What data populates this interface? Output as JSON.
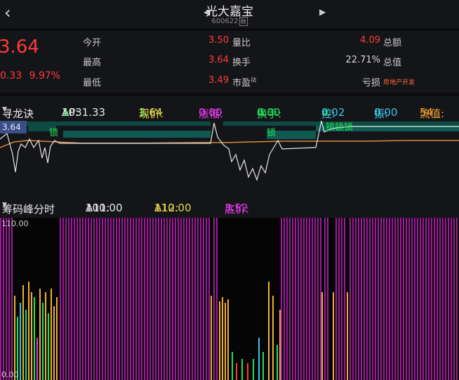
{
  "header": {
    "title": "光大嘉宝",
    "code": "600622",
    "code_tag": "融",
    "back_icon": "chevron-left-icon",
    "prev_icon": "triangle-left-icon",
    "next_icon": "triangle-right-icon"
  },
  "quote": {
    "price": "3.64",
    "change": "0.33",
    "change_pct": "9.97%",
    "rows": [
      {
        "label1": "今开",
        "value1": "3.50",
        "label2": "量比",
        "value2": "4.09",
        "label3": "总额"
      },
      {
        "label1": "最高",
        "value1": "3.64",
        "label2": "换手",
        "value2": "22.71%",
        "label3": "总值"
      },
      {
        "label1": "最低",
        "value1": "3.49",
        "label2": "市盈",
        "label2_sup": "动",
        "value2": "亏损",
        "label3": "房地产开发"
      }
    ]
  },
  "indicator1": {
    "selector": "寻龙诀",
    "items": [
      {
        "label": "AP:",
        "value": "1031.33",
        "arrow": "↓"
      },
      {
        "label": "现价:",
        "value": "3.64",
        "arrow": "↓"
      },
      {
        "label": "涨幅:",
        "value": "0.00"
      },
      {
        "label": "换手:",
        "value": "0.00",
        "arrow": "↓"
      },
      {
        "label": "控:",
        "value": "0.02",
        "arrow": "↓"
      },
      {
        "label": "振:",
        "value": "0.00"
      },
      {
        "label": "流值:",
        "value": "54"
      }
    ],
    "price_tag": "3.64",
    "lock_labels": [
      "锁",
      "锁",
      "锁锁锁"
    ]
  },
  "indicator2": {
    "selector": "筹码峰分时",
    "a11_label": "A11:",
    "a11_value": "100.00",
    "a12_label": "A12:",
    "a12_value": "110.00",
    "base_label": "底价:",
    "base_value": "3.52",
    "y_top": "110.00",
    "y_bottom": "0.00"
  },
  "colors": {
    "up_red": "#ff3b3b",
    "green": "#22e05a",
    "magenta": "#e23be6",
    "yellow": "#e8d84a",
    "cyan": "#38c6e8",
    "orange": "#f0a030",
    "purple_bar": "#a0189e",
    "orange_bar": "#f0b030"
  }
}
